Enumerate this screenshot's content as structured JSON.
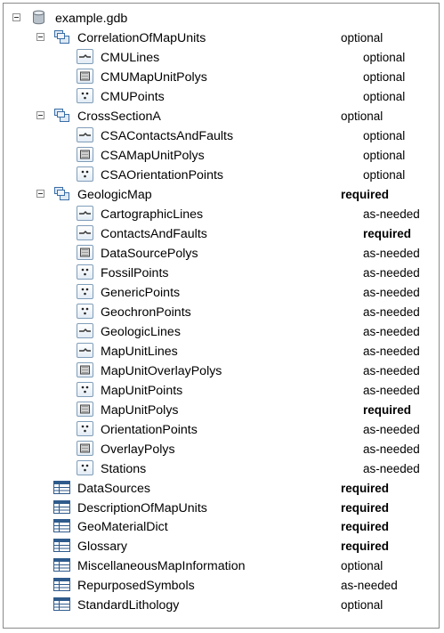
{
  "tree": [
    {
      "label": "example.gdb",
      "icon": "database-icon",
      "level": 0,
      "expander": true,
      "status": ""
    },
    {
      "label": "CorrelationOfMapUnits",
      "icon": "feature-dataset-icon",
      "level": 1,
      "expander": true,
      "status": "optional"
    },
    {
      "label": "CMULines",
      "icon": "line-feature-class-icon",
      "level": 2,
      "expander": false,
      "status": "optional"
    },
    {
      "label": "CMUMapUnitPolys",
      "icon": "polygon-feature-class-icon",
      "level": 2,
      "expander": false,
      "status": "optional"
    },
    {
      "label": "CMUPoints",
      "icon": "point-feature-class-icon",
      "level": 2,
      "expander": false,
      "status": "optional"
    },
    {
      "label": "CrossSectionA",
      "icon": "feature-dataset-icon",
      "level": 1,
      "expander": true,
      "status": "optional"
    },
    {
      "label": "CSAContactsAndFaults",
      "icon": "line-feature-class-icon",
      "level": 2,
      "expander": false,
      "status": "optional"
    },
    {
      "label": "CSAMapUnitPolys",
      "icon": "polygon-feature-class-icon",
      "level": 2,
      "expander": false,
      "status": "optional"
    },
    {
      "label": "CSAOrientationPoints",
      "icon": "point-feature-class-icon",
      "level": 2,
      "expander": false,
      "status": "optional"
    },
    {
      "label": "GeologicMap",
      "icon": "feature-dataset-icon",
      "level": 1,
      "expander": true,
      "status": "required"
    },
    {
      "label": "CartographicLines",
      "icon": "line-feature-class-icon",
      "level": 2,
      "expander": false,
      "status": "as-needed"
    },
    {
      "label": "ContactsAndFaults",
      "icon": "line-feature-class-icon",
      "level": 2,
      "expander": false,
      "status": "required"
    },
    {
      "label": "DataSourcePolys",
      "icon": "polygon-feature-class-icon",
      "level": 2,
      "expander": false,
      "status": "as-needed"
    },
    {
      "label": "FossilPoints",
      "icon": "point-feature-class-icon",
      "level": 2,
      "expander": false,
      "status": "as-needed"
    },
    {
      "label": "GenericPoints",
      "icon": "point-feature-class-icon",
      "level": 2,
      "expander": false,
      "status": "as-needed"
    },
    {
      "label": "GeochronPoints",
      "icon": "point-feature-class-icon",
      "level": 2,
      "expander": false,
      "status": "as-needed"
    },
    {
      "label": "GeologicLines",
      "icon": "line-feature-class-icon",
      "level": 2,
      "expander": false,
      "status": "as-needed"
    },
    {
      "label": "MapUnitLines",
      "icon": "line-feature-class-icon",
      "level": 2,
      "expander": false,
      "status": "as-needed"
    },
    {
      "label": "MapUnitOverlayPolys",
      "icon": "polygon-feature-class-icon",
      "level": 2,
      "expander": false,
      "status": "as-needed"
    },
    {
      "label": "MapUnitPoints",
      "icon": "point-feature-class-icon",
      "level": 2,
      "expander": false,
      "status": "as-needed"
    },
    {
      "label": "MapUnitPolys",
      "icon": "polygon-feature-class-icon",
      "level": 2,
      "expander": false,
      "status": "required"
    },
    {
      "label": "OrientationPoints",
      "icon": "point-feature-class-icon",
      "level": 2,
      "expander": false,
      "status": "as-needed"
    },
    {
      "label": "OverlayPolys",
      "icon": "polygon-feature-class-icon",
      "level": 2,
      "expander": false,
      "status": "as-needed"
    },
    {
      "label": "Stations",
      "icon": "point-feature-class-icon",
      "level": 2,
      "expander": false,
      "status": "as-needed"
    },
    {
      "label": "DataSources",
      "icon": "table-icon",
      "level": 1,
      "expander": false,
      "status": "required"
    },
    {
      "label": "DescriptionOfMapUnits",
      "icon": "table-icon",
      "level": 1,
      "expander": false,
      "status": "required"
    },
    {
      "label": "GeoMaterialDict",
      "icon": "table-icon",
      "level": 1,
      "expander": false,
      "status": "required"
    },
    {
      "label": "Glossary",
      "icon": "table-icon",
      "level": 1,
      "expander": false,
      "status": "required"
    },
    {
      "label": "MiscellaneousMapInformation",
      "icon": "table-icon",
      "level": 1,
      "expander": false,
      "status": "optional"
    },
    {
      "label": "RepurposedSymbols",
      "icon": "table-icon",
      "level": 1,
      "expander": false,
      "status": "as-needed"
    },
    {
      "label": "StandardLithology",
      "icon": "table-icon",
      "level": 1,
      "expander": false,
      "status": "optional"
    }
  ],
  "colors": {
    "icon_border": "#7f9db9",
    "table_header": "#2f5b8c",
    "folder_blue": "#3a6ea5",
    "db_gray": "#a9b3bd"
  }
}
